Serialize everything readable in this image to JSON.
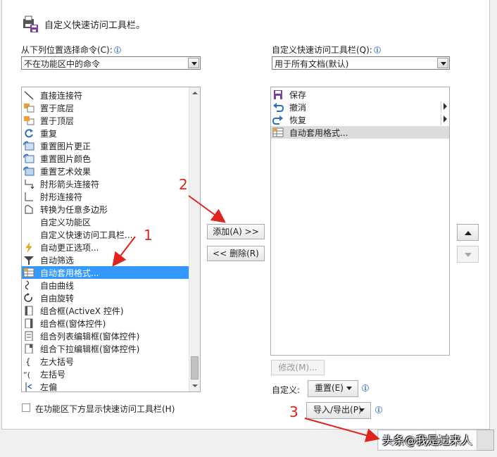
{
  "dialog": {
    "title": "自定义快速访问工具栏。",
    "title_icon": "quick-access-toolbar-icon"
  },
  "left": {
    "label": "从下列位置选择命令(C):",
    "combo_value": "不在功能区中的命令",
    "items": [
      {
        "label": "直接连接符",
        "icon": "line-icon"
      },
      {
        "label": "置于底层",
        "icon": "send-to-back-icon"
      },
      {
        "label": "置于顶层",
        "icon": "bring-to-front-icon"
      },
      {
        "label": "重复",
        "icon": "repeat-icon"
      },
      {
        "label": "重置图片更正",
        "icon": "reset-picture-icon"
      },
      {
        "label": "重置图片颜色",
        "icon": "reset-color-icon"
      },
      {
        "label": "重置艺术效果",
        "icon": "reset-effect-icon"
      },
      {
        "label": "肘形箭头连接符",
        "icon": "elbow-arrow-icon"
      },
      {
        "label": "肘形连接符",
        "icon": "elbow-connector-icon"
      },
      {
        "label": "转换为任意多边形",
        "icon": "freeform-icon"
      },
      {
        "label": "自定义功能区",
        "icon": ""
      },
      {
        "label": "自定义快速访问工具栏...",
        "icon": ""
      },
      {
        "label": "自动更正选项...",
        "icon": "lightning-icon"
      },
      {
        "label": "自动筛选",
        "icon": "filter-icon"
      },
      {
        "label": "自动套用格式...",
        "icon": "autoformat-icon"
      },
      {
        "label": "自由曲线",
        "icon": "scribble-icon"
      },
      {
        "label": "自由旋转",
        "icon": "rotate-icon"
      },
      {
        "label": "组合框(ActiveX 控件)",
        "icon": "combobox-icon"
      },
      {
        "label": "组合框(窗体控件)",
        "icon": "combobox-form-icon"
      },
      {
        "label": "组合列表编辑框(窗体控件)",
        "icon": "combo-list-icon"
      },
      {
        "label": "组合下拉编辑框(窗体控件)",
        "icon": "combo-dropdown-icon"
      },
      {
        "label": "左大括号",
        "icon": "left-brace-icon"
      },
      {
        "label": "左括号",
        "icon": "left-paren-icon"
      },
      {
        "label": "左偏",
        "icon": "left-offset-icon"
      }
    ],
    "selected_index": 14,
    "checkbox_label": "在功能区下方显示快速访问工具栏(H)"
  },
  "right": {
    "label": "自定义快速访问工具栏(Q):",
    "combo_value": "用于所有文档(默认)",
    "items": [
      {
        "label": "保存",
        "icon": "save-icon",
        "submenu": false
      },
      {
        "label": "撤消",
        "icon": "undo-icon",
        "submenu": true
      },
      {
        "label": "恢复",
        "icon": "redo-icon",
        "submenu": true
      },
      {
        "label": "自动套用格式...",
        "icon": "autoformat-icon",
        "submenu": false
      }
    ],
    "highlight_index": 3,
    "modify_label": "修改(M)...",
    "customize_label": "自定义:",
    "reset_label": "重置(E)",
    "import_export_label": "导入/导出(P)"
  },
  "middle": {
    "add_label": "添加(A) >>",
    "remove_label": "<< 删除(R)"
  },
  "annotations": {
    "n1": "1",
    "n2": "2",
    "n3": "3",
    "color": "#e0231c"
  },
  "watermark": "头条@我是过来人"
}
